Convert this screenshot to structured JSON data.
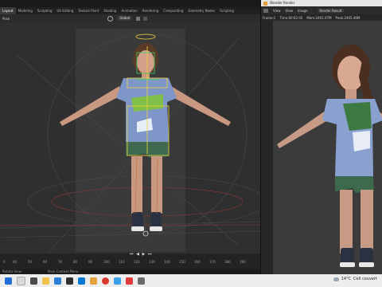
{
  "blender": {
    "tabs": [
      "Layout",
      "Modeling",
      "Sculpting",
      "UV Editing",
      "Texture Paint",
      "Shading",
      "Animation",
      "Rendering",
      "Compositing",
      "Geometry Nodes",
      "Scripting"
    ],
    "toolbar": {
      "mode_label": "Pose",
      "orientation": "Global"
    },
    "timeline": {
      "ticks": [
        "0",
        "40",
        "50",
        "60",
        "70",
        "80",
        "90",
        "100",
        "110",
        "120",
        "130",
        "140",
        "150",
        "160",
        "170",
        "180",
        "190"
      ],
      "playback": "⏮ ◀ ▶ ⏭"
    },
    "status": {
      "left": "Rotate View",
      "middle": "Pose Context Menu"
    }
  },
  "render": {
    "title": "Blender Render",
    "menu": [
      "View",
      "View",
      "Image"
    ],
    "render_result": "Render Result",
    "info": [
      "Frame:1",
      "Time:00:02.92",
      "Mem:2401.07M",
      "Peak:2405.46M"
    ]
  },
  "taskbar": {
    "weather_temp": "14°C",
    "weather_text": "Cell couvert"
  },
  "colors": {
    "accent": "#e5a03b",
    "rig_yellow": "#f2d33a",
    "taskbar": "#ededed"
  }
}
